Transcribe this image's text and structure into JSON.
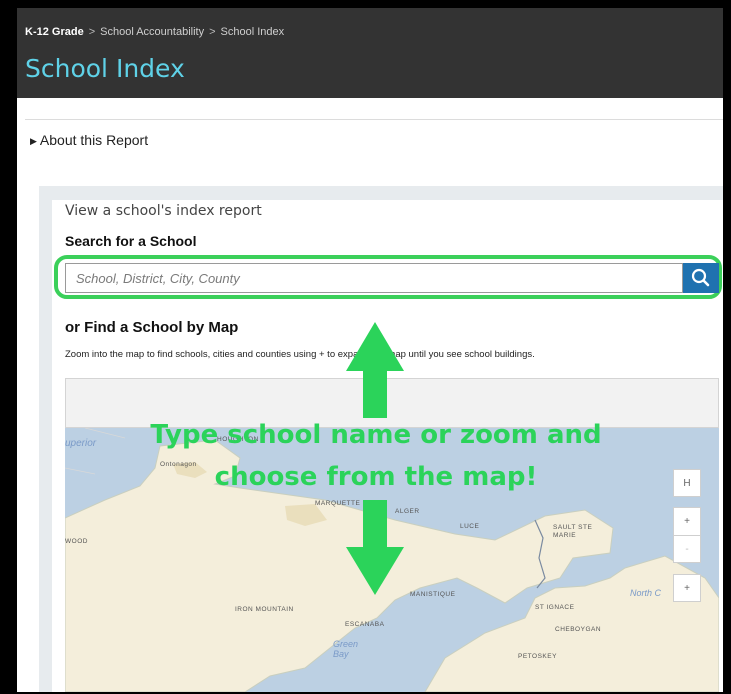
{
  "breadcrumb": [
    "K-12 Grade",
    "School Accountability",
    "School Index"
  ],
  "breadcrumb_separator": ">",
  "page_title": "School Index",
  "about": {
    "label": "About this Report"
  },
  "search": {
    "intro": "View a school's index report",
    "label": "Search for a School",
    "placeholder": "School, District, City, County",
    "value": ""
  },
  "map_section": {
    "heading": "or Find a School by Map",
    "help": "Zoom into the map to find schools, cities and counties using + to expand the map until you see school buildings.",
    "controls": {
      "home": "H",
      "zoom_in": "+",
      "zoom_out": "-",
      "expand": "+"
    },
    "labels": {
      "superior": "uperior",
      "houghton": "HOUGHTON",
      "ontonagon": "Ontonagon",
      "wood": "WOOD",
      "marquette": "MARQUETTE",
      "alger": "ALGER",
      "luce": "LUCE",
      "sault": "SAULT STE\nMARIE",
      "iron_mountain": "IRON MOUNTAIN",
      "escanaba": "ESCANABA",
      "manistique": "MANISTIQUE",
      "st_ignace": "ST IGNACE",
      "cheboygan": "CHEBOYGAN",
      "petoskey": "PETOSKEY",
      "green_bay": "Green\nBay",
      "north": "North C"
    }
  },
  "overlay": {
    "line1": "Type school name or zoom and",
    "line2": "choose from the map!",
    "color": "#2bd35a"
  },
  "colors": {
    "header_bg": "#333333",
    "title": "#5fd2e8",
    "search_button": "#1f72b0",
    "highlight_ring": "#3bd05a",
    "map_water": "#bcd0e3",
    "map_land": "#f4eedb"
  }
}
